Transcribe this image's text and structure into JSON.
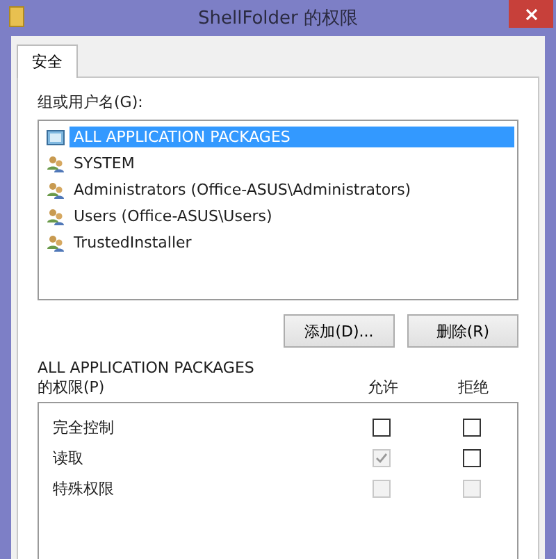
{
  "window": {
    "title": "ShellFolder 的权限"
  },
  "tabs": [
    {
      "label": "安全",
      "selected": true
    }
  ],
  "groups": {
    "label": "组或用户名(G):",
    "items": [
      {
        "name": "ALL APPLICATION PACKAGES",
        "kind": "package",
        "selected": true
      },
      {
        "name": "SYSTEM",
        "kind": "group",
        "selected": false
      },
      {
        "name": "Administrators (Office-ASUS\\Administrators)",
        "kind": "group",
        "selected": false
      },
      {
        "name": "Users (Office-ASUS\\Users)",
        "kind": "group",
        "selected": false
      },
      {
        "name": "TrustedInstaller",
        "kind": "group",
        "selected": false
      }
    ]
  },
  "buttons": [
    "添加(D)...",
    "删除(R)"
  ],
  "permissions": {
    "subject": "ALL APPLICATION PACKAGES",
    "label": "的权限(P)",
    "columns": [
      "允许",
      "拒绝"
    ],
    "rows": [
      {
        "name": "完全控制",
        "allow": {
          "checked": false,
          "disabled": false
        },
        "deny": {
          "checked": false,
          "disabled": false
        }
      },
      {
        "name": "读取",
        "allow": {
          "checked": true,
          "disabled": true
        },
        "deny": {
          "checked": false,
          "disabled": false
        }
      },
      {
        "name": "特殊权限",
        "allow": {
          "checked": false,
          "disabled": true
        },
        "deny": {
          "checked": false,
          "disabled": true
        }
      }
    ]
  }
}
